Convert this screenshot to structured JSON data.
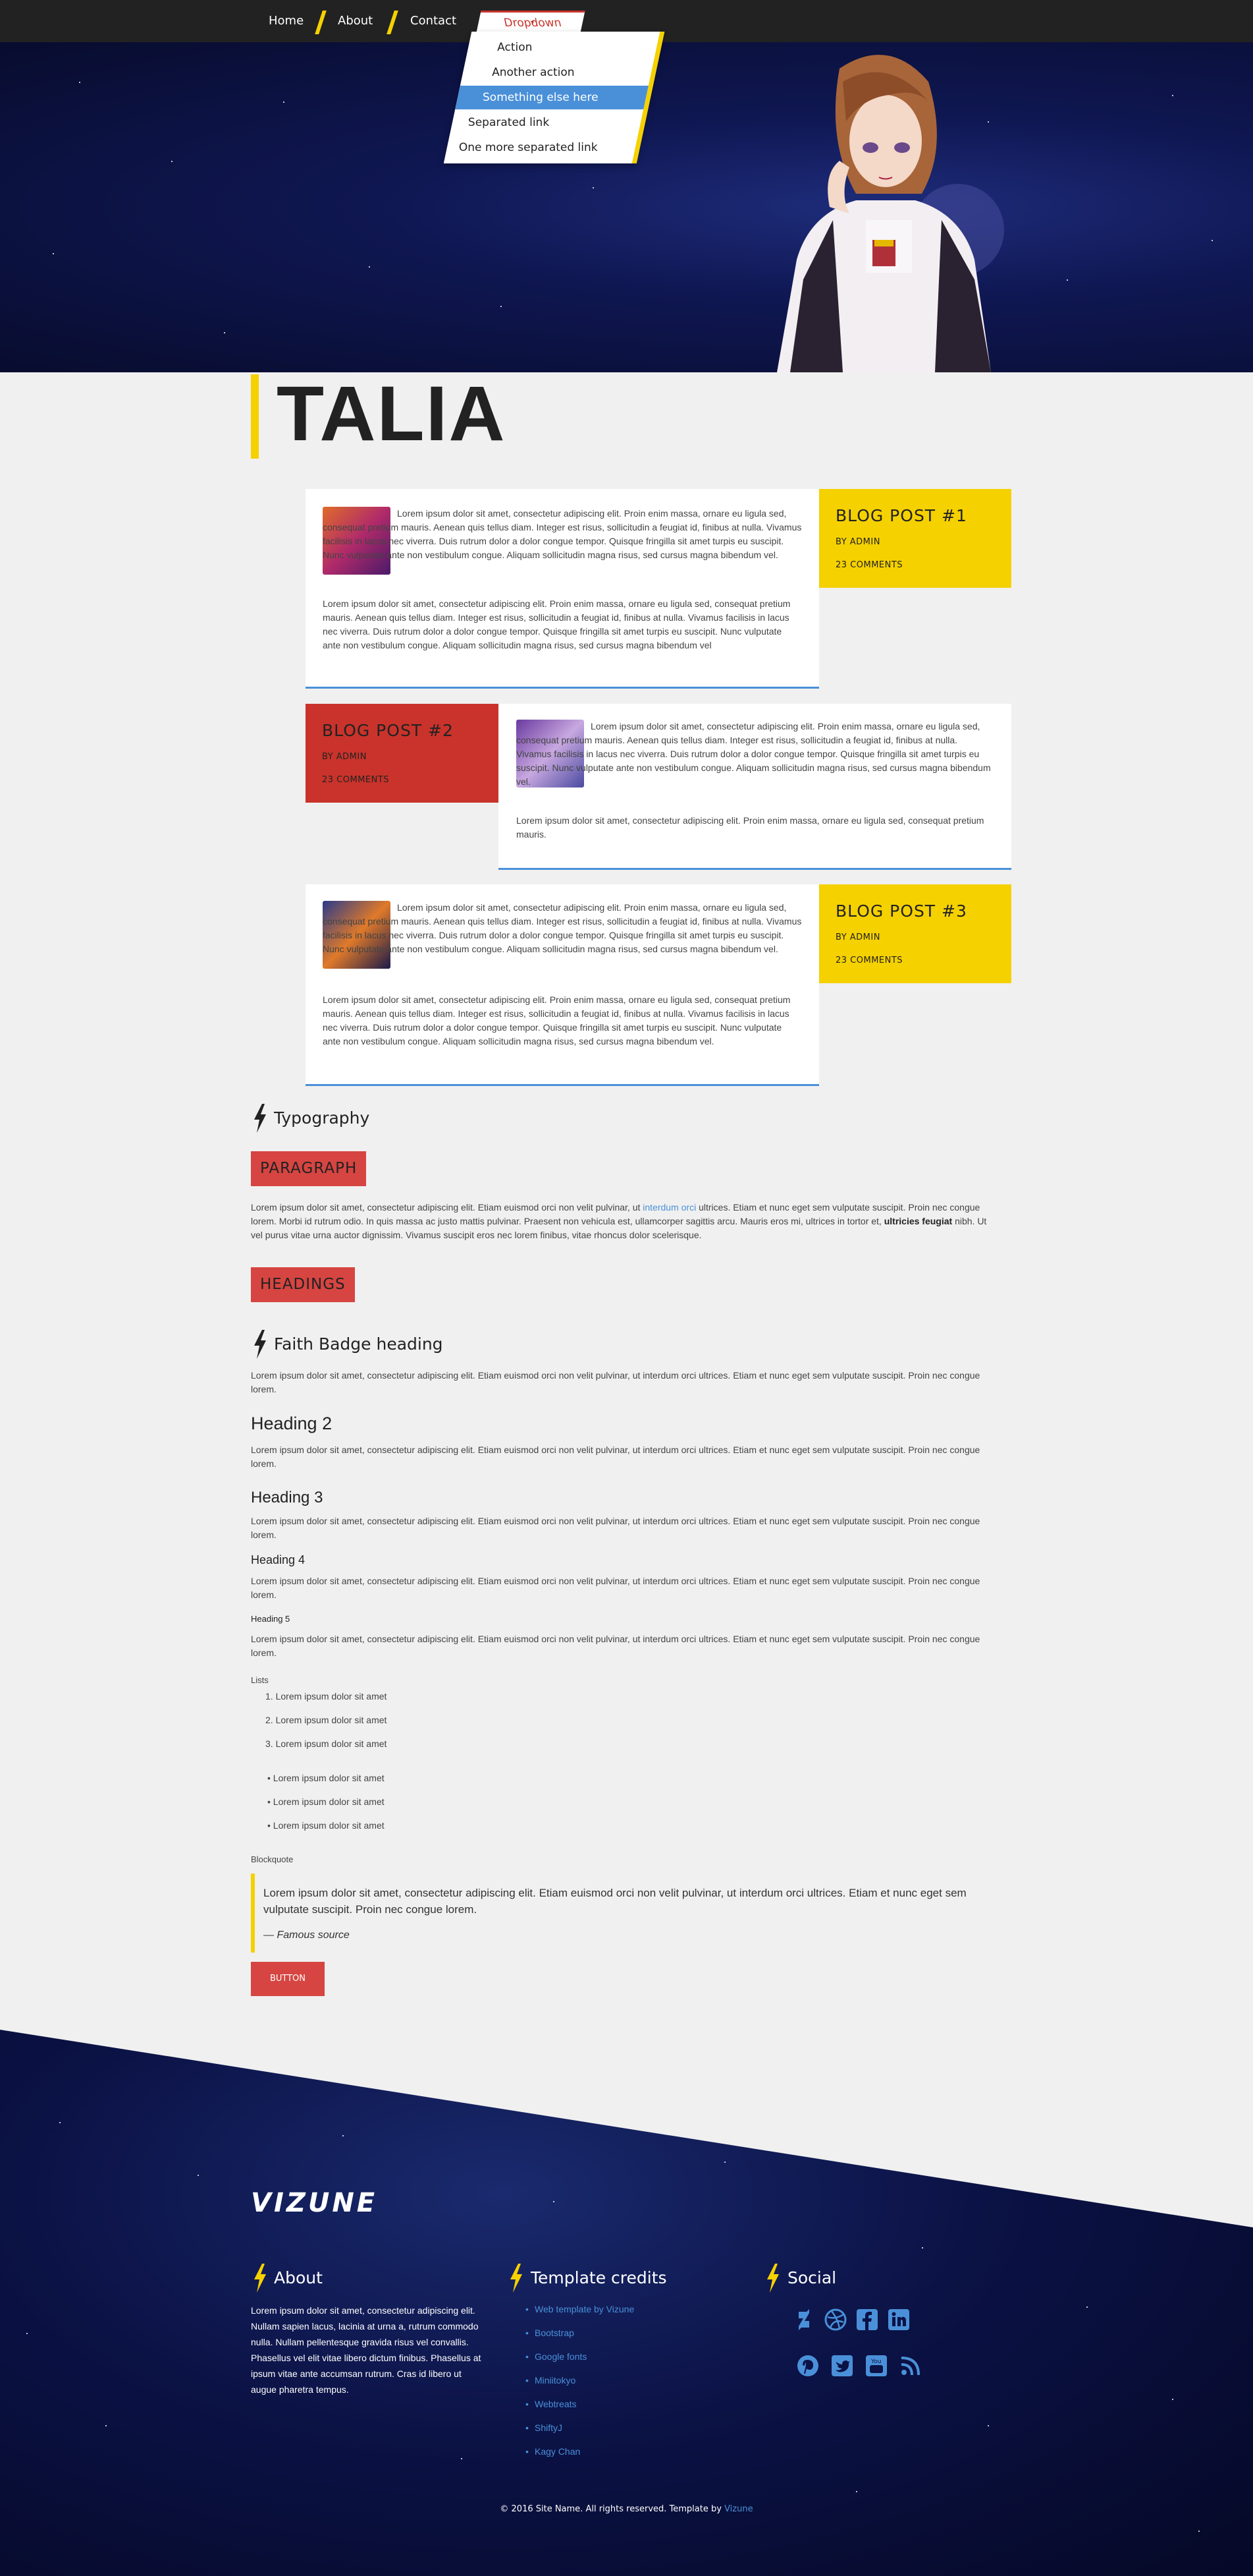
{
  "nav": {
    "items": [
      "Home",
      "About",
      "Contact"
    ],
    "dropdown_label": "Dropdown",
    "dropdown_items": [
      "Action",
      "Another action",
      "Something else here",
      "Separated link",
      "One more separated link"
    ]
  },
  "page_title": "TALIA",
  "posts": [
    {
      "title": "BLOG POST #1",
      "author": "BY ADMIN",
      "comments": "23 COMMENTS",
      "p1": "Lorem ipsum dolor sit amet, consectetur adipiscing elit. Proin enim massa, ornare eu ligula sed, consequat pretium mauris. Aenean quis tellus diam. Integer est risus, sollicitudin a feugiat id, finibus at nulla. Vivamus facilisis in lacus nec viverra. Duis rutrum dolor a dolor congue tempor. Quisque fringilla sit amet turpis eu suscipit. Nunc vulputate ante non vestibulum congue. Aliquam sollicitudin magna risus, sed cursus magna bibendum vel.",
      "p2": "Lorem ipsum dolor sit amet, consectetur adipiscing elit. Proin enim massa, ornare eu ligula sed, consequat pretium mauris. Aenean quis tellus diam. Integer est risus, sollicitudin a feugiat id, finibus at nulla. Vivamus facilisis in lacus nec viverra. Duis rutrum dolor a dolor congue tempor. Quisque fringilla sit amet turpis eu suscipit. Nunc vulputate ante non vestibulum congue. Aliquam sollicitudin magna risus, sed cursus magna bibendum vel"
    },
    {
      "title": "BLOG POST #2",
      "author": "BY ADMIN",
      "comments": "23 COMMENTS",
      "p1": "Lorem ipsum dolor sit amet, consectetur adipiscing elit. Proin enim massa, ornare eu ligula sed, consequat pretium mauris. Aenean quis tellus diam. Integer est risus, sollicitudin a feugiat id, finibus at nulla. Vivamus facilisis in lacus nec viverra. Duis rutrum dolor a dolor congue tempor. Quisque fringilla sit amet turpis eu suscipit. Nunc vulputate ante non vestibulum congue. Aliquam sollicitudin magna risus, sed cursus magna bibendum vel.",
      "p2": "Lorem ipsum dolor sit amet, consectetur adipiscing elit. Proin enim massa, ornare eu ligula sed, consequat pretium mauris."
    },
    {
      "title": "BLOG POST #3",
      "author": "BY ADMIN",
      "comments": "23 COMMENTS",
      "p1": "Lorem ipsum dolor sit amet, consectetur adipiscing elit. Proin enim massa, ornare eu ligula sed, consequat pretium mauris. Aenean quis tellus diam. Integer est risus, sollicitudin a feugiat id, finibus at nulla. Vivamus facilisis in lacus nec viverra. Duis rutrum dolor a dolor congue tempor. Quisque fringilla sit amet turpis eu suscipit. Nunc vulputate ante non vestibulum congue. Aliquam sollicitudin magna risus, sed cursus magna bibendum vel.",
      "p2": "Lorem ipsum dolor sit amet, consectetur adipiscing elit. Proin enim massa, ornare eu ligula sed, consequat pretium mauris. Aenean quis tellus diam. Integer est risus, sollicitudin a feugiat id, finibus at nulla. Vivamus facilisis in lacus nec viverra. Duis rutrum dolor a dolor congue tempor. Quisque fringilla sit amet turpis eu suscipit. Nunc vulputate ante non vestibulum congue. Aliquam sollicitudin magna risus, sed cursus magna bibendum vel."
    }
  ],
  "typography": {
    "title": "Typography",
    "paragraph_badge": "PARAGRAPH",
    "para_a": "Lorem ipsum dolor sit amet, consectetur adipiscing elit. Etiam euismod orci non velit pulvinar, ut ",
    "para_link": "interdum orci",
    "para_b": " ultrices. Etiam et nunc eget sem vulputate suscipit. Proin nec congue lorem. Morbi id rutrum odio. In quis massa ac justo mattis pulvinar. Praesent non vehicula est, ullamcorper sagittis arcu. Mauris eros mi, ultrices in tortor et, ",
    "para_bold": "ultricies feugiat",
    "para_c": " nibh. Ut vel purus vitae urna auctor dignissim. Vivamus suscipit eros nec lorem finibus, vitae rhoncus dolor scelerisque.",
    "headings_badge": "HEADINGS",
    "h1": "Faith Badge heading",
    "h2": "Heading 2",
    "h3": "Heading 3",
    "h4": "Heading 4",
    "h5": "Heading 5",
    "body": "Lorem ipsum dolor sit amet, consectetur adipiscing elit. Etiam euismod orci non velit pulvinar, ut interdum orci ultrices. Etiam et nunc eget sem vulputate suscipit. Proin nec congue lorem.",
    "lists_label": "Lists",
    "ol": [
      "Lorem ipsum dolor sit amet",
      "Lorem ipsum dolor sit amet",
      "Lorem ipsum dolor sit amet"
    ],
    "ul": [
      "Lorem ipsum dolor sit amet",
      "Lorem ipsum dolor sit amet",
      "Lorem ipsum dolor sit amet"
    ],
    "blockquote_label": "Blockquote",
    "quote": "Lorem ipsum dolor sit amet, consectetur adipiscing elit. Etiam euismod orci non velit pulvinar, ut interdum orci ultrices. Etiam et nunc eget sem vulputate suscipit. Proin nec congue lorem.",
    "quote_source": "— Famous source",
    "button": "BUTTON"
  },
  "footer": {
    "logo": "VIZUNE",
    "about_title": "About",
    "about_text": "Lorem ipsum dolor sit amet, consectetur adipiscing elit. Nullam sapien lacus, lacinia at urna a, rutrum commodo nulla. Nullam pellentesque gravida risus vel convallis. Phasellus vel elit vitae libero dictum finibus. Phasellus at ipsum vitae ante accumsan rutrum. Cras id libero ut augue pharetra tempus.",
    "credits_title": "Template credits",
    "credits": [
      "Web template by Vizune",
      "Bootstrap",
      "Google fonts",
      "Miniitokyo",
      "Webtreats",
      "ShiftyJ",
      "Kagy Chan"
    ],
    "social_title": "Social",
    "social_icons": [
      "deviantart-icon",
      "dribbble-icon",
      "facebook-icon",
      "linkedin-icon",
      "pinterest-icon",
      "twitter-icon",
      "youtube-icon",
      "rss-icon"
    ],
    "copyright": "© 2016 Site Name. All rights reserved. Template by ",
    "copyright_link": "Vizune"
  },
  "colors": {
    "accent_yellow": "#f5d100",
    "accent_red": "#c9332b",
    "link_blue": "#4a90d9",
    "nav_bg": "#222222"
  }
}
